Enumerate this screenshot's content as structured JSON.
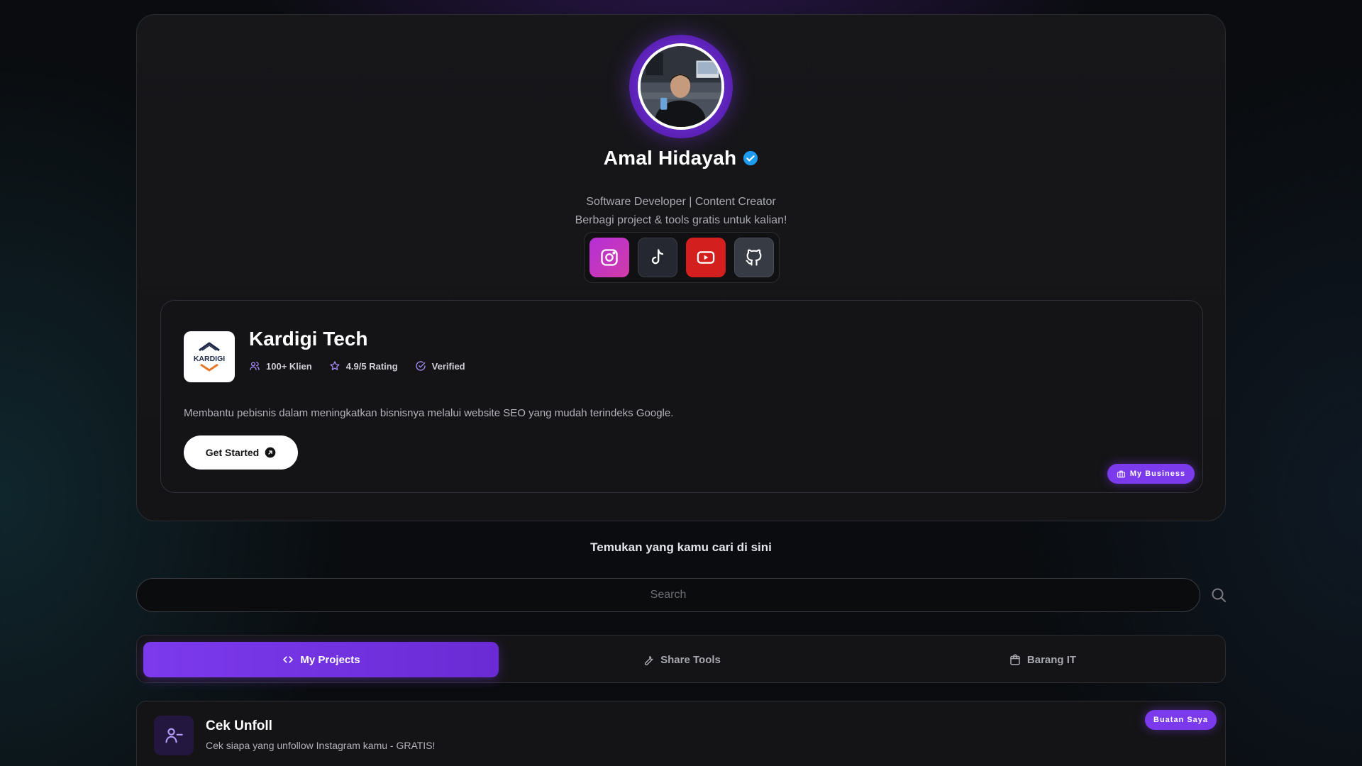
{
  "profile": {
    "name": "Amal Hidayah",
    "tagline": "Software Developer | Content Creator",
    "bio": "Berbagi project & tools gratis untuk kalian!",
    "verified_icon": "verified-check-icon",
    "socials": [
      {
        "name": "instagram",
        "icon": "instagram-icon",
        "color": "#c236c8"
      },
      {
        "name": "tiktok",
        "icon": "tiktok-icon",
        "color": "#252830"
      },
      {
        "name": "youtube",
        "icon": "youtube-icon",
        "color": "#d41f1f"
      },
      {
        "name": "github",
        "icon": "github-icon",
        "color": "#373b44"
      }
    ]
  },
  "business": {
    "logo_text": "KARDIGI",
    "title": "Kardigi Tech",
    "stats": [
      {
        "icon": "users-icon",
        "label": "100+ Klien"
      },
      {
        "icon": "star-icon",
        "label": "4.9/5 Rating"
      },
      {
        "icon": "check-circle-icon",
        "label": "Verified"
      }
    ],
    "description": "Membantu pebisnis dalam meningkatkan bisnisnya melalui website SEO yang mudah terindeks Google.",
    "cta_label": "Get Started",
    "badge_label": "My Business"
  },
  "search": {
    "heading": "Temukan yang kamu cari di sini",
    "placeholder": "Search",
    "value": ""
  },
  "tabs": [
    {
      "label": "My Projects",
      "icon": "code-icon",
      "active": true
    },
    {
      "label": "Share Tools",
      "icon": "wrench-icon",
      "active": false
    },
    {
      "label": "Barang IT",
      "icon": "shopping-bag-icon",
      "active": false
    }
  ],
  "projects": [
    {
      "title": "Cek Unfoll",
      "description": "Cek siapa yang unfollow Instagram kamu - GRATIS!",
      "badge": "Buatan Saya",
      "icon": "user-minus-icon"
    }
  ],
  "colors": {
    "accent": "#7c3aed",
    "background": "#0a0c0f",
    "card": "#141416"
  }
}
